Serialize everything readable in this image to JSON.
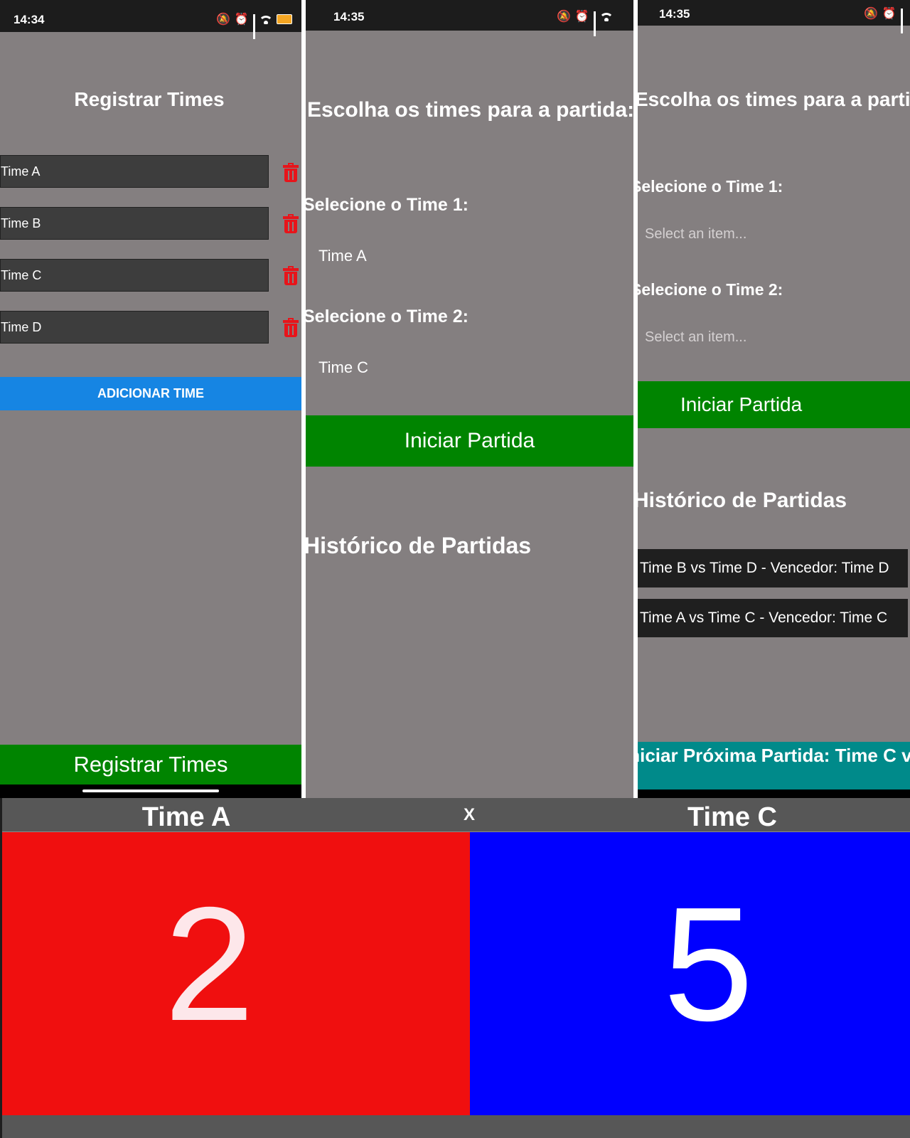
{
  "screen1": {
    "status_time": "14:34",
    "title": "Registrar Times",
    "teams": [
      "Time A",
      "Time B",
      "Time C",
      "Time D"
    ],
    "add_button": "ADICIONAR TIME",
    "register_button": "Registrar Times"
  },
  "screen2": {
    "status_time": "14:35",
    "title": "Escolha os times para a partida:",
    "select1_label": "Selecione o Time 1:",
    "select1_value": "Time A",
    "select2_label": "Selecione o Time 2:",
    "select2_value": "Time C",
    "start_button": "Iniciar Partida",
    "history_title": "Histórico de Partidas"
  },
  "screen3": {
    "status_time": "14:35",
    "title": "Escolha os times para a partida:",
    "select1_label": "Selecione o Time 1:",
    "select1_placeholder": "Select an item...",
    "select2_label": "Selecione o Time 2:",
    "select2_placeholder": "Select an item...",
    "start_button": "Iniciar Partida",
    "history_title": "Histórico de Partidas",
    "history": [
      "Time B vs Time D - Vencedor: Time D",
      "Time A  vs Time C - Vencedor: Time C"
    ],
    "next_button": "Iniciar Próxima Partida: Time C vs"
  },
  "scoreboard": {
    "team1": "Time A",
    "separator": "X",
    "team2": "Time C",
    "score1": "2",
    "score2": "5",
    "colors": {
      "team1_bg": "#f00f0f",
      "team2_bg": "#0000ff",
      "header_bg": "#575757"
    }
  }
}
